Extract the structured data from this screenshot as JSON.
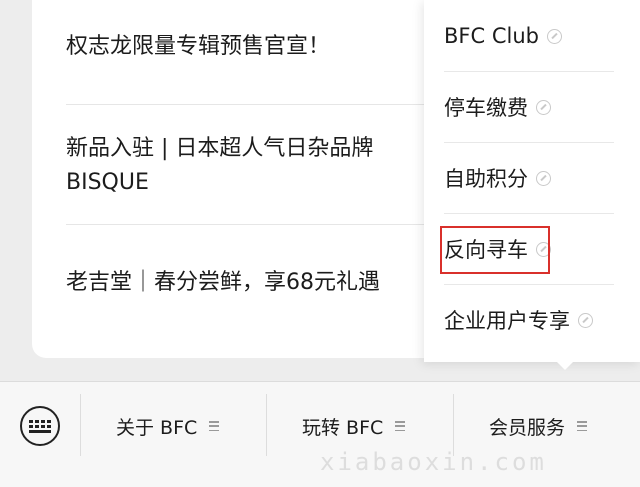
{
  "articles": [
    {
      "title": "权志龙限量专辑预售官宣！"
    },
    {
      "title": "新品入驻 | 日本超人气日杂品牌BISQUE"
    },
    {
      "title": "老吉堂｜春分尝鲜，享68元礼遇"
    }
  ],
  "menu": {
    "items": [
      {
        "label": "BFC Club",
        "icon": "link-icon"
      },
      {
        "label": "停车缴费",
        "icon": "link-icon"
      },
      {
        "label": "自助积分",
        "icon": "link-icon"
      },
      {
        "label": "反向寻车",
        "icon": "link-icon",
        "highlighted": true
      },
      {
        "label": "企业用户专享",
        "icon": "link-icon"
      }
    ],
    "highlight_color": "#d9302b"
  },
  "bottom_bar": {
    "keyboard_icon": "keyboard-icon",
    "tabs": [
      {
        "label": "关于 BFC",
        "icon": "menu-icon"
      },
      {
        "label": "玩转 BFC",
        "icon": "menu-icon"
      },
      {
        "label": "会员服务",
        "icon": "menu-icon"
      }
    ]
  },
  "watermark": "xiabaoxin.com"
}
